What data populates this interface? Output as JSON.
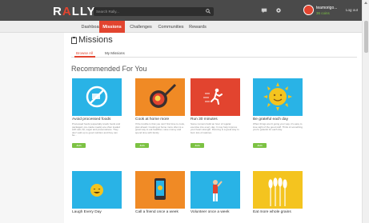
{
  "header": {
    "logo_text": "RALLY",
    "search_placeholder": "Search Rally...",
    "username": "teamorigo...",
    "coins": "36 coins",
    "logout_label": "Log out"
  },
  "nav": {
    "items": [
      {
        "label": "Dashboard"
      },
      {
        "label": "Missions"
      },
      {
        "label": "Challenges"
      },
      {
        "label": "Communities"
      },
      {
        "label": "Rewards"
      }
    ]
  },
  "page": {
    "title": "Missions",
    "tabs": [
      {
        "label": "Browse All"
      },
      {
        "label": "My Missions"
      }
    ],
    "section_title": "Recommended For You"
  },
  "cards": [
    {
      "title": "Avoid processed foods",
      "desc": "Processed foods (especially snack foods and packaged, pre-made meals) are often loaded with salt, fat, sugar and preservatives. They don't add up to good nutrition and they can be...",
      "button": "Join"
    },
    {
      "title": "Cook at home more",
      "desc": "If the trouble is that you can't find time to cook, plan ahead. Cooking at home more often is a great way to eat healthier, save money and spend time with family.",
      "button": "Join"
    },
    {
      "title": "Run 30 minutes",
      "desc": "Some runners build an hour of regular exercise into every day. It may help improve your heart strength. Running is a great way to burn lots of calories.",
      "button": "Join"
    },
    {
      "title": "Be grateful each day",
      "desc": "When things aren't going your way, it's easy to lose sight of the good stuff. Think of something you're grateful for each day.",
      "button": "Join"
    },
    {
      "title": "Laugh Every Day",
      "desc": "",
      "button": ""
    },
    {
      "title": "Call a friend once a week",
      "desc": "",
      "button": ""
    },
    {
      "title": "Volunteer once a week",
      "desc": "",
      "button": ""
    },
    {
      "title": "Eat more whole grains",
      "desc": "",
      "button": ""
    }
  ],
  "colors": {
    "accent": "#e2442f",
    "header_bg": "#4a4a4a",
    "join_green": "#7cc243",
    "card_blue": "#29b3e6",
    "card_orange": "#f08a25",
    "card_red": "#e2442f",
    "card_yellow": "#f4c41f"
  }
}
